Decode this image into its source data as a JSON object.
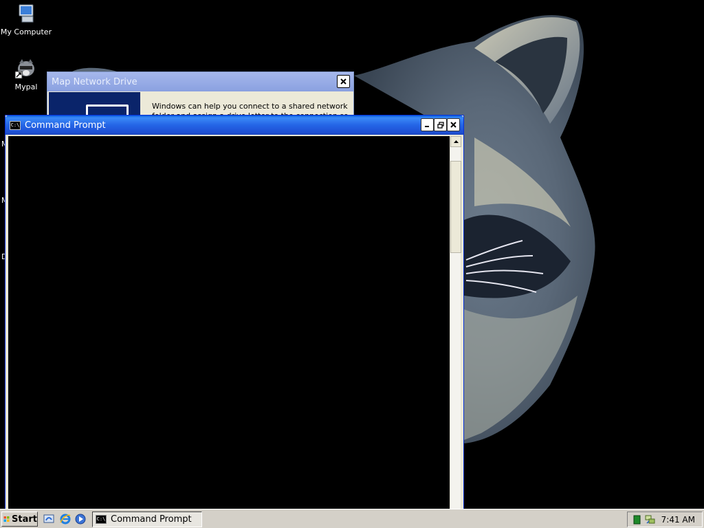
{
  "desktop": {
    "icons": [
      {
        "label": "My Computer",
        "icon": "my-computer-icon"
      },
      {
        "label": "Mypal",
        "icon": "mypal-raccoon-icon"
      }
    ],
    "edge_fragments": [
      "M",
      "M",
      "D"
    ]
  },
  "windows": {
    "map_network_drive": {
      "title": "Map Network Drive",
      "description": "Windows can help you connect to a shared network folder and assign a drive letter to the connection so that you can"
    },
    "command_prompt": {
      "title": "Command Prompt",
      "icon_text": "C:\\"
    }
  },
  "taskbar": {
    "start_label": "Start",
    "quick_launch": [
      "show-desktop-icon",
      "internet-explorer-icon",
      "media-player-icon"
    ],
    "tasks": [
      {
        "label": "Command Prompt",
        "active": true
      }
    ],
    "clock": "7:41 AM"
  },
  "colors": {
    "titlebar_active": "#2465e6",
    "titlebar_inactive": "#a6b8ec",
    "taskbar": "#d4d0c8",
    "console_bg": "#000000"
  }
}
